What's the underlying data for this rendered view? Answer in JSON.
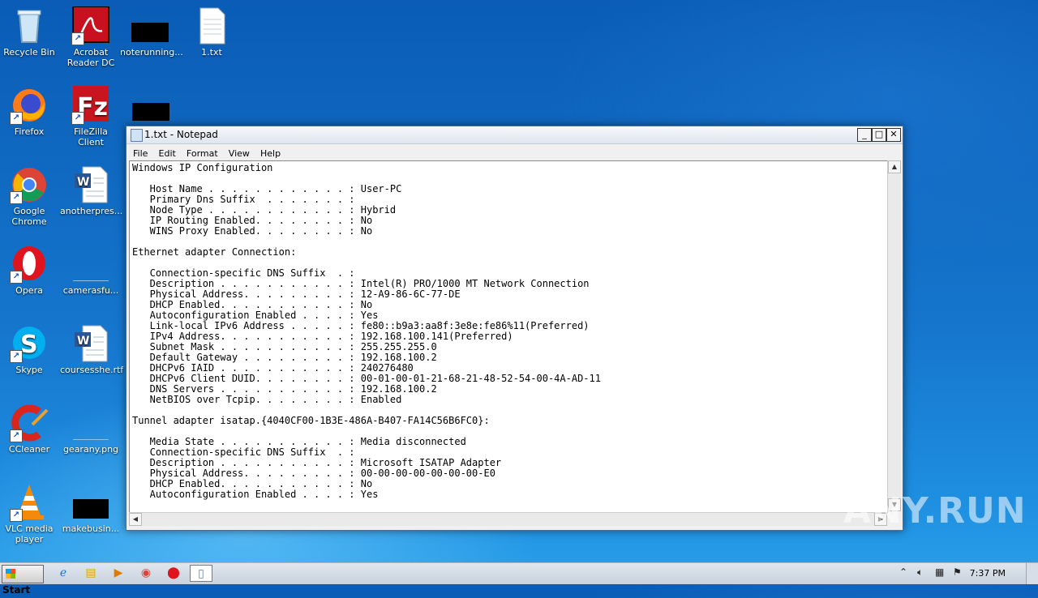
{
  "desktop": {
    "icons": [
      {
        "label": "Recycle Bin"
      },
      {
        "label": "Acrobat Reader DC"
      },
      {
        "label": "noterunning..."
      },
      {
        "label": "1.txt"
      },
      {
        "label": "Firefox"
      },
      {
        "label": "FileZilla Client"
      },
      {
        "label": "Google Chrome"
      },
      {
        "label": "anotherpres..."
      },
      {
        "label": "Opera"
      },
      {
        "label": "camerasfu..."
      },
      {
        "label": "Skype"
      },
      {
        "label": "coursesshe.rtf"
      },
      {
        "label": "CCleaner"
      },
      {
        "label": "gearany.png"
      },
      {
        "label": "VLC media player"
      },
      {
        "label": "makebusin..."
      }
    ]
  },
  "window": {
    "title": "1.txt - Notepad",
    "menu": [
      "File",
      "Edit",
      "Format",
      "View",
      "Help"
    ],
    "content": "Windows IP Configuration\n\n   Host Name . . . . . . . . . . . . : User-PC\n   Primary Dns Suffix  . . . . . . . :\n   Node Type . . . . . . . . . . . . : Hybrid\n   IP Routing Enabled. . . . . . . . : No\n   WINS Proxy Enabled. . . . . . . . : No\n\nEthernet adapter Connection:\n\n   Connection-specific DNS Suffix  . :\n   Description . . . . . . . . . . . : Intel(R) PRO/1000 MT Network Connection\n   Physical Address. . . . . . . . . : 12-A9-86-6C-77-DE\n   DHCP Enabled. . . . . . . . . . . : No\n   Autoconfiguration Enabled . . . . : Yes\n   Link-local IPv6 Address . . . . . : fe80::b9a3:aa8f:3e8e:fe86%11(Preferred)\n   IPv4 Address. . . . . . . . . . . : 192.168.100.141(Preferred)\n   Subnet Mask . . . . . . . . . . . : 255.255.255.0\n   Default Gateway . . . . . . . . . : 192.168.100.2\n   DHCPv6 IAID . . . . . . . . . . . : 240276480\n   DHCPv6 Client DUID. . . . . . . . : 00-01-00-01-21-68-21-48-52-54-00-4A-AD-11\n   DNS Servers . . . . . . . . . . . : 192.168.100.2\n   NetBIOS over Tcpip. . . . . . . . : Enabled\n\nTunnel adapter isatap.{4040CF00-1B3E-486A-B407-FA14C56B6FC0}:\n\n   Media State . . . . . . . . . . . : Media disconnected\n   Connection-specific DNS Suffix  . :\n   Description . . . . . . . . . . . : Microsoft ISATAP Adapter\n   Physical Address. . . . . . . . . : 00-00-00-00-00-00-00-E0\n   DHCP Enabled. . . . . . . . . . . : No\n   Autoconfiguration Enabled . . . . : Yes"
  },
  "taskbar": {
    "start_label": "Start",
    "clock": "7:37 PM"
  },
  "watermark": "ANY.RUN"
}
